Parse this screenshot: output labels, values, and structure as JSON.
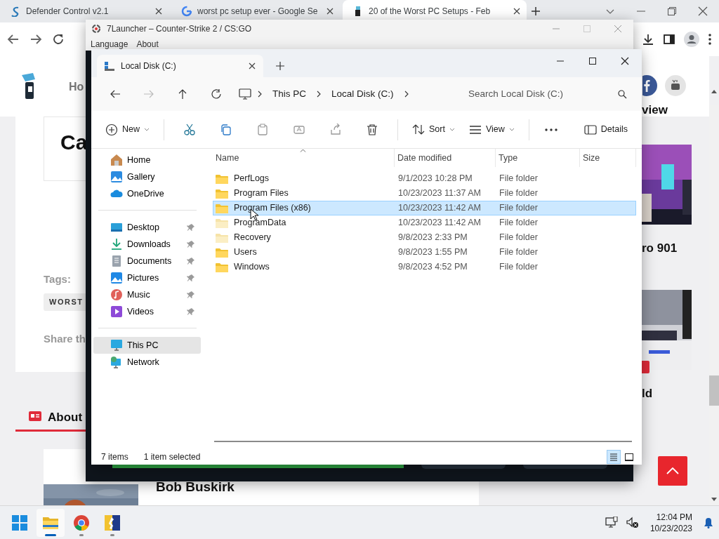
{
  "browser": {
    "tabs": [
      {
        "title": "Defender Control v2.1",
        "selected": false
      },
      {
        "title": "worst pc setup ever - Google Se",
        "selected": false
      },
      {
        "title": "20 of the Worst PC Setups - Feb",
        "selected": true
      }
    ]
  },
  "webpage": {
    "nav_text": "Ho",
    "card_heading": "Ca",
    "tags_label": "Tags:",
    "tag": "WORST",
    "share_text": "Share th",
    "about_heading": "About",
    "author_name": "Bob Buskirk",
    "sidebar_heading": "view",
    "posts": [
      {
        "title": "ro 901",
        "badge": false
      },
      {
        "title": "ld",
        "badge": true
      }
    ]
  },
  "launcher": {
    "title": "7Launcher – Counter-Strike 2 / CS:GO",
    "menu": [
      "Language",
      "About"
    ]
  },
  "explorer": {
    "tab_title": "Local Disk (C:)",
    "forward_disabled": true,
    "breadcrumb": [
      "This PC",
      "Local Disk (C:)"
    ],
    "search_placeholder": "Search Local Disk (C:)",
    "commands": [
      {
        "kind": "menu",
        "label": "New"
      },
      {
        "kind": "icon",
        "disabled": false
      },
      {
        "kind": "icon",
        "disabled": false
      },
      {
        "kind": "icon",
        "disabled": true
      },
      {
        "kind": "icon",
        "disabled": true
      },
      {
        "kind": "icon",
        "disabled": true
      },
      {
        "kind": "icon",
        "disabled": false
      },
      {
        "kind": "menu",
        "label": "Sort"
      },
      {
        "kind": "menu",
        "label": "View"
      },
      {
        "kind": "more"
      },
      {
        "kind": "toggle",
        "label": "Details"
      }
    ],
    "nav": [
      [
        {
          "label": "Home",
          "pinned": false,
          "selected": false
        },
        {
          "label": "Gallery",
          "pinned": false,
          "selected": false
        },
        {
          "label": "OneDrive",
          "pinned": false,
          "selected": false
        }
      ],
      [
        {
          "label": "Desktop",
          "pinned": true,
          "selected": false
        },
        {
          "label": "Downloads",
          "pinned": true,
          "selected": false
        },
        {
          "label": "Documents",
          "pinned": true,
          "selected": false
        },
        {
          "label": "Pictures",
          "pinned": true,
          "selected": false
        },
        {
          "label": "Music",
          "pinned": true,
          "selected": false
        },
        {
          "label": "Videos",
          "pinned": true,
          "selected": false
        }
      ],
      [
        {
          "label": "This PC",
          "pinned": false,
          "selected": true
        },
        {
          "label": "Network",
          "pinned": false,
          "selected": false
        }
      ]
    ],
    "columns": [
      {
        "label": "Name",
        "sorted": true
      },
      {
        "label": "Date modified",
        "sorted": false
      },
      {
        "label": "Type",
        "sorted": false
      },
      {
        "label": "Size",
        "sorted": false
      }
    ],
    "files": [
      {
        "name": "PerfLogs",
        "date": "9/1/2023 10:28 PM",
        "type": "File folder",
        "hidden": false,
        "selected": false
      },
      {
        "name": "Program Files",
        "date": "10/23/2023 11:37 AM",
        "type": "File folder",
        "hidden": false,
        "selected": false
      },
      {
        "name": "Program Files (x86)",
        "date": "10/23/2023 11:42 AM",
        "type": "File folder",
        "hidden": false,
        "selected": true
      },
      {
        "name": "ProgramData",
        "date": "10/23/2023 11:42 AM",
        "type": "File folder",
        "hidden": true,
        "selected": false
      },
      {
        "name": "Recovery",
        "date": "9/8/2023 2:33 PM",
        "type": "File folder",
        "hidden": true,
        "selected": false
      },
      {
        "name": "Users",
        "date": "9/8/2023 1:55 PM",
        "type": "File folder",
        "hidden": false,
        "selected": false
      },
      {
        "name": "Windows",
        "date": "9/8/2023 4:52 PM",
        "type": "File folder",
        "hidden": false,
        "selected": false
      }
    ],
    "status": {
      "count": "7 items",
      "selection": "1 item selected"
    },
    "view_modes": [
      {
        "selected": true
      },
      {
        "selected": false
      }
    ]
  },
  "taskbar": {
    "apps": [
      {
        "running": false,
        "active": false
      },
      {
        "running": true,
        "active": true
      },
      {
        "running": true,
        "active": false
      },
      {
        "running": true,
        "active": false
      }
    ],
    "time": "12:04 PM",
    "date": "10/23/2023"
  }
}
